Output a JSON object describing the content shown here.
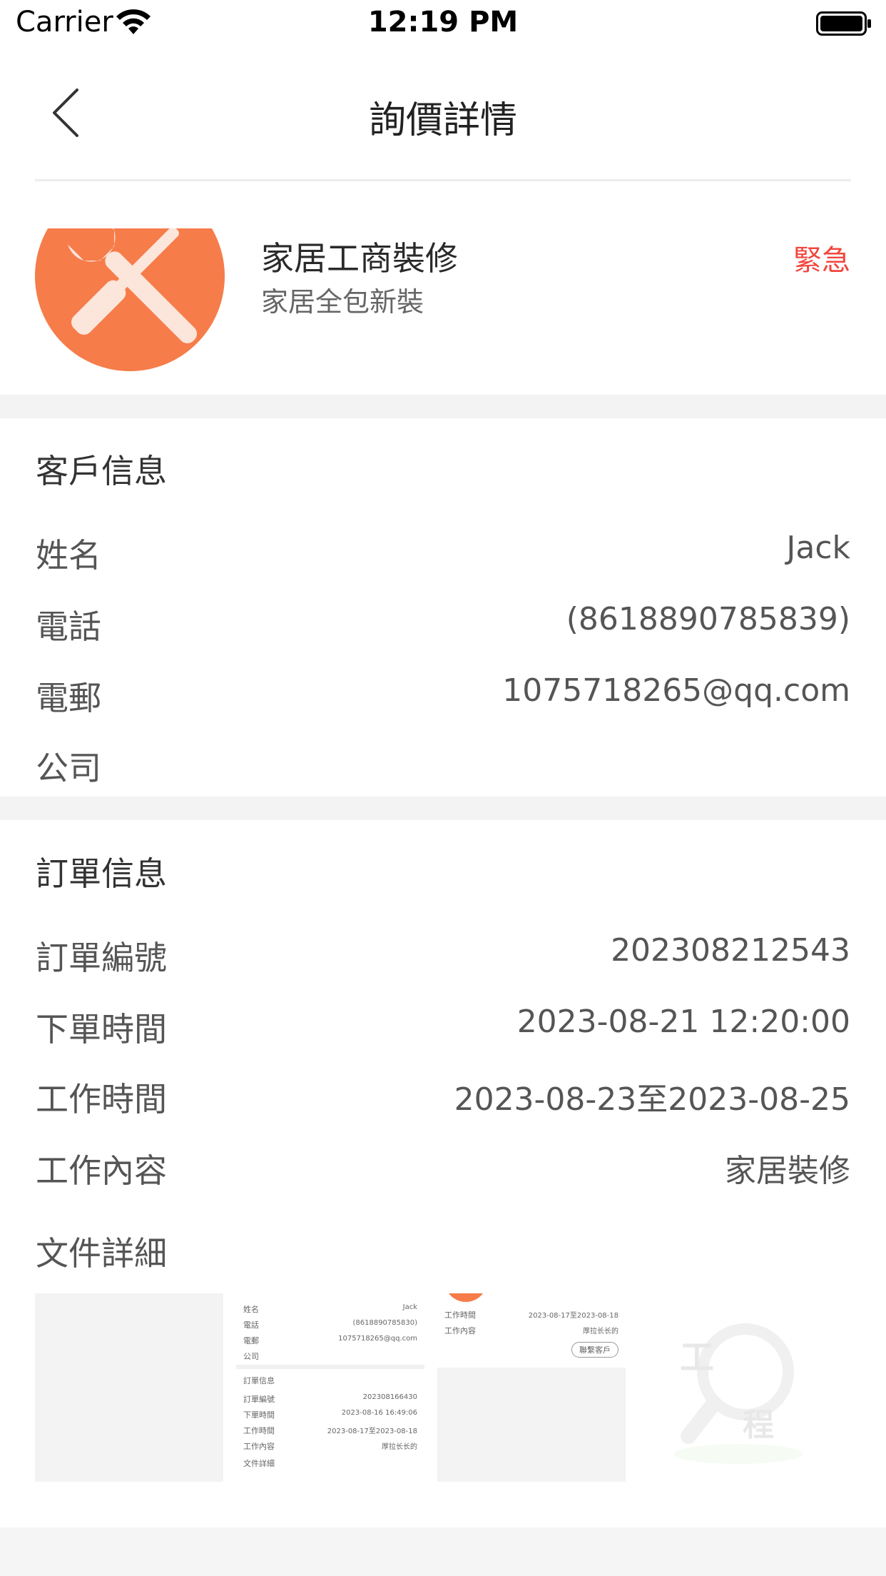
{
  "status_bar": {
    "carrier": "Carrier",
    "time": "12:19 PM",
    "wifi_icon": "wifi-icon",
    "battery_icon": "battery-icon"
  },
  "nav": {
    "title": "詢價詳情",
    "back_icon": "chevron-left-icon"
  },
  "service": {
    "title": "家居工商裝修",
    "subtitle": "家居全包新裝",
    "urgency": "緊急",
    "icon": "wrench-screwdriver-icon",
    "icon_color": "#F67C4A"
  },
  "customer": {
    "section_title": "客戶信息",
    "rows": [
      {
        "label": "姓名",
        "value": "Jack"
      },
      {
        "label": "電話",
        "value": "(8618890785839)"
      },
      {
        "label": "電郵",
        "value": "1075718265@qq.com"
      },
      {
        "label": "公司",
        "value": ""
      }
    ]
  },
  "order": {
    "section_title": "訂單信息",
    "rows": [
      {
        "label": "訂單編號",
        "value": "202308212543"
      },
      {
        "label": "下單時間",
        "value": "2023-08-21 12:20:00"
      },
      {
        "label": "工作時間",
        "value": "2023-08-23至2023-08-25"
      },
      {
        "label": "工作內容",
        "value": "家居裝修"
      }
    ],
    "files_label": "文件詳細"
  },
  "attachments": {
    "thumb2": {
      "rows": [
        {
          "label": "姓名",
          "value": "Jack"
        },
        {
          "label": "電話",
          "value": "(8618890785830)"
        },
        {
          "label": "電郵",
          "value": "1075718265@qq.com"
        },
        {
          "label": "公司",
          "value": ""
        }
      ],
      "section": "訂單信息",
      "order_rows": [
        {
          "label": "訂單編號",
          "value": "202308166430"
        },
        {
          "label": "下單時間",
          "value": "2023-08-16 16:49:06"
        },
        {
          "label": "工作時間",
          "value": "2023-08-17至2023-08-18"
        },
        {
          "label": "工作內容",
          "value": "厚拉长长的"
        }
      ],
      "files": "文件詳細"
    },
    "thumb3": {
      "rows": [
        {
          "label": "工作時間",
          "value": "2023-08-17至2023-08-18"
        },
        {
          "label": "工作內容",
          "value": "厚拉长长的"
        }
      ],
      "button": "聯繫客戶"
    },
    "thumb4": {
      "char1": "工",
      "char2": "程"
    }
  },
  "colors": {
    "accent": "#F67C4A",
    "urgent": "#F1463E",
    "gap": "#F3F3F3"
  }
}
